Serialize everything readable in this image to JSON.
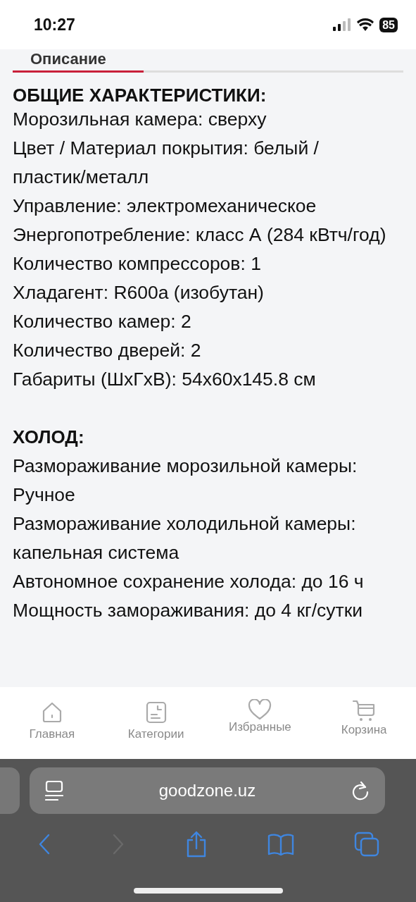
{
  "status_bar": {
    "time": "10:27",
    "battery": "85"
  },
  "tab": {
    "label": "Описание"
  },
  "sections": [
    {
      "heading": "ОБЩИЕ ХАРАКТЕРИСТИКИ:",
      "lines": [
        "Морозильная камера: сверху",
        "Цвет / Материал покрытия: белый / пластик/металл",
        "Управление: электромеханическое",
        "Энергопотребление: класс А (284 кВтч/год)",
        "Количество компрессоров: 1",
        "Хладагент: R600a (изобутан)",
        "Количество камер: 2",
        "Количество дверей: 2",
        "Габариты (ШхГхВ): 54x60x145.8 см"
      ]
    },
    {
      "heading": "ХОЛОД:",
      "lines": [
        "Размораживание морозильной камеры: Ручное",
        "Размораживание холодильной камеры: капельная система",
        "Автономное сохранение холода: до 16 ч",
        "Мощность замораживания: до 4 кг/сутки"
      ]
    }
  ],
  "bottom_nav": [
    {
      "kind": "home",
      "label": "Главная"
    },
    {
      "kind": "categories",
      "label": "Категории"
    },
    {
      "kind": "favorites",
      "label": "Избранные"
    },
    {
      "kind": "cart",
      "label": "Корзина"
    }
  ],
  "browser": {
    "url": "goodzone.uz",
    "forward_disabled": true
  }
}
